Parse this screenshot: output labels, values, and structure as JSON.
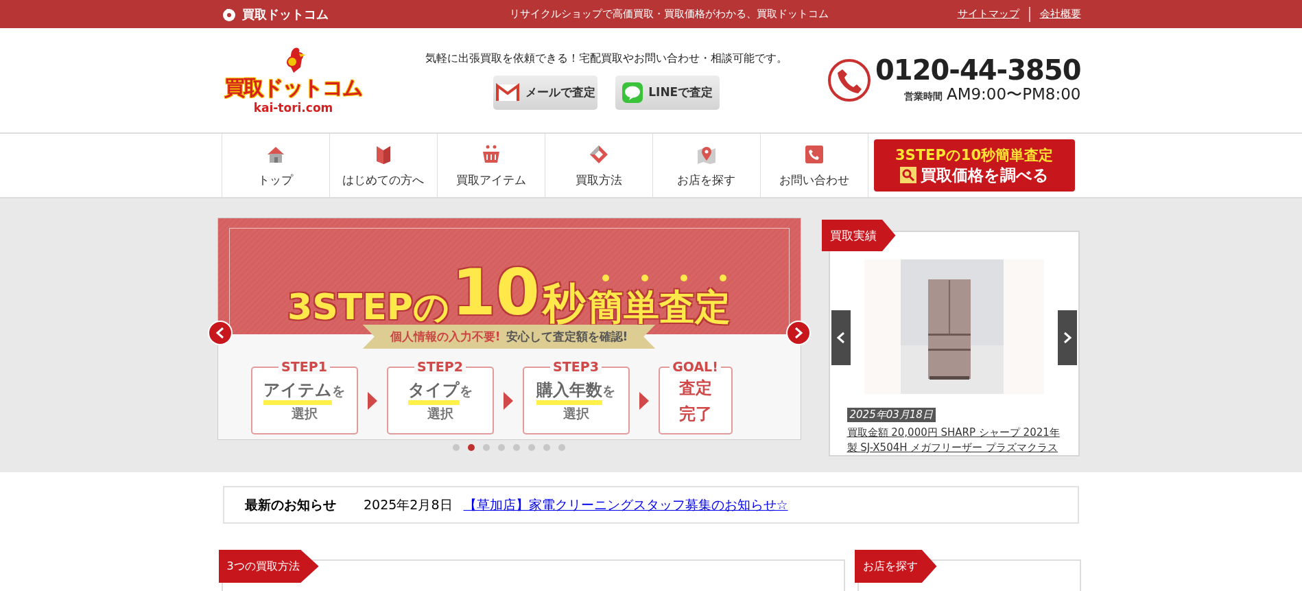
{
  "top_bar": {
    "brand": "買取ドットコム",
    "tagline": "リサイクルショップで高価買取・買取価格がわかる、買取ドットコム",
    "links": [
      "サイトマップ",
      "会社概要"
    ]
  },
  "header": {
    "logo": {
      "name": "買取ドットコム",
      "domain": "kai-tori.com"
    },
    "message": "気軽に出張買取を依頼できる！宅配買取やお問い合わせ・相談可能です。",
    "buttons": [
      {
        "label": "メールで査定",
        "kind": "mail"
      },
      {
        "label": "LINEで査定",
        "kind": "line"
      }
    ],
    "phone": "0120-44-3850",
    "hours_label": "営業時間",
    "hours": "AM9:00〜PM8:00"
  },
  "nav": {
    "items": [
      {
        "label": "トップ",
        "kind": "home"
      },
      {
        "label": "はじめての方へ",
        "kind": "guide"
      },
      {
        "label": "買取アイテム",
        "kind": "basket"
      },
      {
        "label": "買取方法",
        "kind": "method"
      },
      {
        "label": "お店を探す",
        "kind": "map"
      },
      {
        "label": "お問い合わせ",
        "kind": "contact"
      }
    ],
    "cta": {
      "line1": "3STEPの10秒簡単査定",
      "line2": "買取価格を調べる"
    }
  },
  "carousel": {
    "title_parts": [
      "3STEPの",
      "10",
      "秒",
      "簡単査定"
    ],
    "ribbon": [
      "個人情報の入力不要!",
      "安心して査定額を確認!"
    ],
    "steps": [
      {
        "kind": "step",
        "label": "STEP1",
        "main": "アイテム",
        "suffix": "を",
        "line2": "選択"
      },
      {
        "kind": "step",
        "label": "STEP2",
        "main": "タイプ",
        "suffix": "を",
        "line2": "選択"
      },
      {
        "kind": "step",
        "label": "STEP3",
        "main": "購入年数",
        "suffix": "を",
        "line2": "選択"
      },
      {
        "kind": "goal",
        "label": "GOAL!",
        "main": "査定",
        "line2": "完了"
      }
    ],
    "dots": [
      {
        "selected": false
      },
      {
        "selected": true
      },
      {
        "selected": false
      },
      {
        "selected": false
      },
      {
        "selected": false
      },
      {
        "selected": false
      },
      {
        "selected": false
      },
      {
        "selected": false
      }
    ]
  },
  "results": {
    "tag": "買取実績",
    "date": "2025年03月18日",
    "link": "買取金額 20,000円 SHARP シャープ 2021年製 SJ-X504H メガフリーザー プラズマクラス"
  },
  "news": {
    "heading": "最新のお知らせ",
    "date": "2025年2月8日",
    "link": "【草加店】家電クリーニングスタッフ募集のお知らせ☆"
  },
  "sections": [
    {
      "tag": "3つの買取方法"
    },
    {
      "tag": "お店を探す"
    }
  ]
}
